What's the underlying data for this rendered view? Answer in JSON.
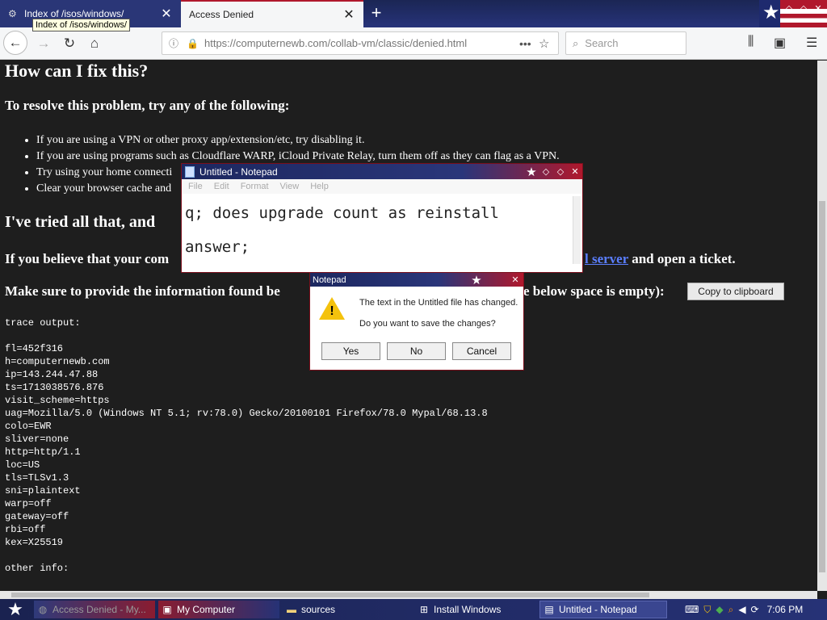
{
  "browser": {
    "tabs": [
      {
        "title": "Index of /isos/windows/",
        "active": false
      },
      {
        "title": "Access Denied",
        "active": true
      }
    ],
    "tooltip": "Index of /isos/windows/",
    "url": "https://computernewb.com/collab-vm/classic/denied.html",
    "search_placeholder": "Search"
  },
  "page": {
    "heading_fix": "How can I fix this?",
    "heading_resolve": "To resolve this problem, try any of the following:",
    "bullets": [
      "If you are using a VPN or other proxy app/extension/etc, try disabling it.",
      "If you are using programs such as Cloudflare WARP, iCloud Private Relay, turn them off as they can flag as a VPN.",
      "Try using your home connecti",
      "Clear your browser cache and"
    ],
    "heading_tried": "I've tried all that, and",
    "believe_text": "If you believe that your com",
    "believe_link": "l server",
    "believe_tail": "and open a ticket.",
    "provide_text": "Make sure to provide the information found be",
    "provide_tail": "e below space is empty):",
    "copy_button": "Copy to clipboard",
    "trace_label": "trace output:",
    "trace_lines": [
      "fl=452f316",
      "h=computernewb.com",
      "ip=143.244.47.88",
      "ts=1713038576.876",
      "visit_scheme=https",
      "uag=Mozilla/5.0 (Windows NT 5.1; rv:78.0) Gecko/20100101 Firefox/78.0 Mypal/68.13.8",
      "colo=EWR",
      "sliver=none",
      "http=http/1.1",
      "loc=US",
      "tls=TLSv1.3",
      "sni=plaintext",
      "warp=off",
      "gateway=off",
      "rbi=off",
      "kex=X25519"
    ],
    "other_label": "other info:"
  },
  "notepad": {
    "title": "Untitled - Notepad",
    "menu": [
      "File",
      "Edit",
      "Format",
      "View",
      "Help"
    ],
    "line1": "q; does upgrade count as reinstall",
    "line2": "answer;"
  },
  "dialog": {
    "title": "Notepad",
    "message1": "The text in the Untitled file has changed.",
    "message2": "Do you want to save the changes?",
    "yes": "Yes",
    "no": "No",
    "cancel": "Cancel"
  },
  "taskbar": {
    "items": [
      "Access Denied - My...",
      "My Computer",
      "sources",
      "Install Windows",
      "Untitled - Notepad"
    ],
    "clock": "7:06 PM"
  }
}
